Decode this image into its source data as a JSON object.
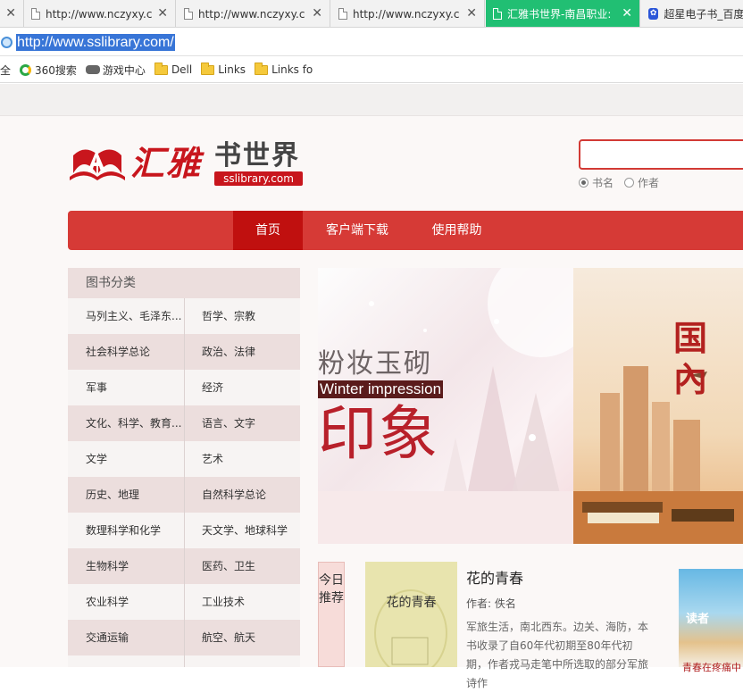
{
  "browser": {
    "tabs": [
      {
        "label": "http://www.nczyxy.co",
        "active": false,
        "icon": "page-icon"
      },
      {
        "label": "http://www.nczyxy.co",
        "active": false,
        "icon": "page-icon"
      },
      {
        "label": "http://www.nczyxy.co",
        "active": false,
        "icon": "page-icon"
      },
      {
        "label": "汇雅书世界-南昌职业:",
        "active": true,
        "icon": "page-icon"
      },
      {
        "label": "超星电子书_百度",
        "active": false,
        "icon": "baidu-paw-icon"
      }
    ],
    "address": "http://www.sslibrary.com/",
    "bookmarks": [
      {
        "label": "全",
        "icon": ""
      },
      {
        "label": "360搜索",
        "icon": "360-icon"
      },
      {
        "label": "游戏中心",
        "icon": "gamepad-icon"
      },
      {
        "label": "Dell",
        "icon": "folder-icon"
      },
      {
        "label": "Links",
        "icon": "folder-icon"
      },
      {
        "label": "Links fo",
        "icon": "folder-icon"
      }
    ]
  },
  "header": {
    "logo_main": "汇雅",
    "logo_sub": "书世界",
    "logo_domain": "sslibrary.com",
    "search_value": "",
    "radio_options": [
      {
        "label": "书名",
        "checked": true
      },
      {
        "label": "作者",
        "checked": false
      }
    ]
  },
  "nav": {
    "items": [
      "首页",
      "客户端下载",
      "使用帮助"
    ]
  },
  "sidebar": {
    "title": "图书分类",
    "rows": [
      [
        "马列主义、毛泽东...",
        "哲学、宗教"
      ],
      [
        "社会科学总论",
        "政治、法律"
      ],
      [
        "军事",
        "经济"
      ],
      [
        "文化、科学、教育...",
        "语言、文字"
      ],
      [
        "文学",
        "艺术"
      ],
      [
        "历史、地理",
        "自然科学总论"
      ],
      [
        "数理科学和化学",
        "天文学、地球科学"
      ],
      [
        "生物科学",
        "医药、卫生"
      ],
      [
        "农业科学",
        "工业技术"
      ],
      [
        "交通运输",
        "航空、航天"
      ]
    ]
  },
  "banner": {
    "left_title": "粉妆玉砌",
    "left_en": "Winter impression",
    "left_big": "印象",
    "right_title": "国內"
  },
  "recommend": {
    "label": "今日推荐",
    "cover_title": "花的青春",
    "title": "花的青春",
    "author": "作者: 佚名",
    "desc": "军旅生活，南北西东。边关、海防，本书收录了自60年代初期至80年代初期，作者戎马走笔中所选取的部分军旅诗作"
  },
  "side_book": {
    "mag": "读者",
    "caption": "青春在疼痛中"
  },
  "colors": {
    "brand_red": "#d63a36",
    "nav_active": "#c0100f",
    "active_tab": "#21bf73",
    "url_highlight": "#3875d7"
  }
}
